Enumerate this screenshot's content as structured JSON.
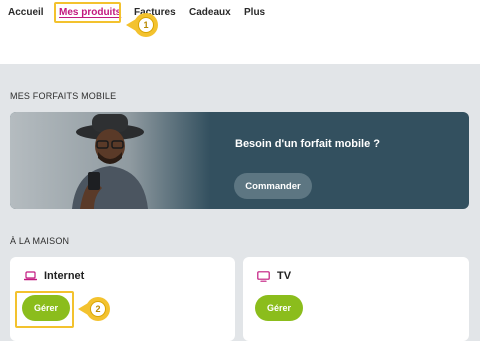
{
  "nav": {
    "items": [
      {
        "label": "Accueil",
        "active": false
      },
      {
        "label": "Mes produits",
        "active": true
      },
      {
        "label": "Factures",
        "active": false
      },
      {
        "label": "Cadeaux",
        "active": false
      },
      {
        "label": "Plus",
        "active": false
      }
    ]
  },
  "callouts": {
    "first": "1",
    "second": "2"
  },
  "mobile_section": {
    "title": "MES FORFAITS MOBILE",
    "banner_title": "Besoin d'un forfait mobile ?",
    "banner_button": "Commander"
  },
  "home_section": {
    "title": "À LA MAISON",
    "cards": [
      {
        "title": "Internet",
        "icon": "laptop-icon",
        "button": "Gérer"
      },
      {
        "title": "TV",
        "icon": "tv-icon",
        "button": "Gérer"
      }
    ]
  },
  "colors": {
    "accent": "#c2187f",
    "highlight": "#f3c22e",
    "button_green": "#8bbd1c",
    "banner_bg": "#33505f",
    "page_bg": "#e2e5e8"
  }
}
